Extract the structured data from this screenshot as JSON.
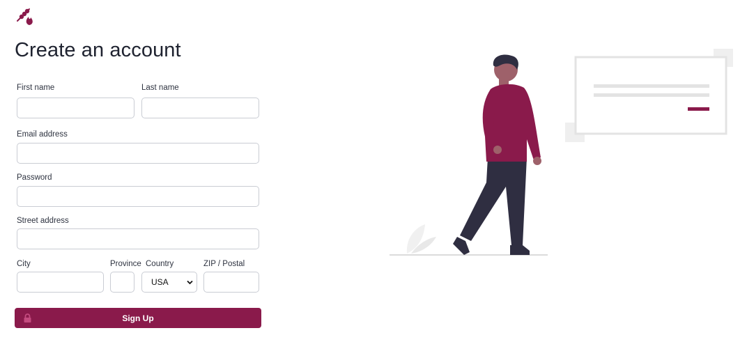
{
  "page": {
    "title": "Create an account"
  },
  "logo": {
    "icon": "barbecue-skewer-flame-icon"
  },
  "form": {
    "first_name": {
      "label": "First name",
      "value": ""
    },
    "last_name": {
      "label": "Last name",
      "value": ""
    },
    "email": {
      "label": "Email address",
      "value": ""
    },
    "password": {
      "label": "Password",
      "value": ""
    },
    "street": {
      "label": "Street address",
      "value": ""
    },
    "city": {
      "label": "City",
      "value": ""
    },
    "province": {
      "label": "Province",
      "value": ""
    },
    "country": {
      "label": "Country",
      "value": "USA"
    },
    "zip": {
      "label": "ZIP / Postal",
      "value": ""
    },
    "submit": {
      "label": "Sign Up",
      "icon": "lock-icon"
    }
  },
  "colors": {
    "brand": "#8a1a4b",
    "brand_icon": "#c44b7f",
    "border": "#c9ccd3",
    "text": "#1f2330"
  }
}
